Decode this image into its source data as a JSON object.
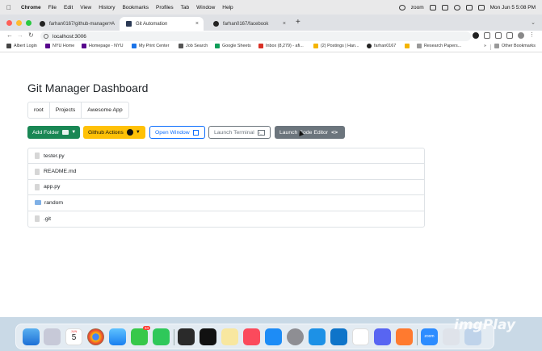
{
  "menubar": {
    "app": "Chrome",
    "items": [
      "File",
      "Edit",
      "View",
      "History",
      "Bookmarks",
      "Profiles",
      "Tab",
      "Window",
      "Help"
    ],
    "zoom_label": "zoom",
    "datetime": "Mon Jun 5  5:08 PM"
  },
  "tabs": [
    {
      "title": "farhan0167/github-manager: A",
      "active": false
    },
    {
      "title": "Git Automation",
      "active": true
    },
    {
      "title": "farhan0167/facebook",
      "active": false
    }
  ],
  "address": "localhost:3006",
  "bookmarks": [
    {
      "label": "Albert Login",
      "color": "#444"
    },
    {
      "label": "NYU Home",
      "color": "#57068c"
    },
    {
      "label": "Homepage - NYU",
      "color": "#57068c"
    },
    {
      "label": "My Print Center",
      "color": "#1a73e8"
    },
    {
      "label": "Job Search",
      "color": "#555"
    },
    {
      "label": "Google Sheets",
      "color": "#0f9d58"
    },
    {
      "label": "Inbox (8,279) - afi...",
      "color": "#d93025"
    },
    {
      "label": "(2) Postings | Han...",
      "color": "#f4b400"
    },
    {
      "label": "farhan0167",
      "color": "#222"
    },
    {
      "label": "Research Papers...",
      "color": "#f4b400"
    }
  ],
  "other_bookmarks": "Other Bookmarks",
  "page": {
    "title": "Git Manager Dashboard",
    "breadcrumb": [
      "root",
      "Projects",
      "Awesome App"
    ],
    "buttons": {
      "add_folder": "Add Folder",
      "github_actions": "Github Actions",
      "open_window": "Open Window",
      "launch_terminal": "Launch Terminal",
      "launch_code_editor": "Launch Code Editor"
    },
    "files": [
      {
        "name": "tester.py",
        "type": "file"
      },
      {
        "name": "README.md",
        "type": "file"
      },
      {
        "name": "app.py",
        "type": "file"
      },
      {
        "name": "random",
        "type": "folder"
      },
      {
        "name": ".git",
        "type": "file"
      }
    ]
  },
  "dock": {
    "calendar_month": "JUN",
    "calendar_day": "5",
    "messages_badge": "34",
    "zoom_label": "zoom"
  },
  "watermark": "imgPlay"
}
